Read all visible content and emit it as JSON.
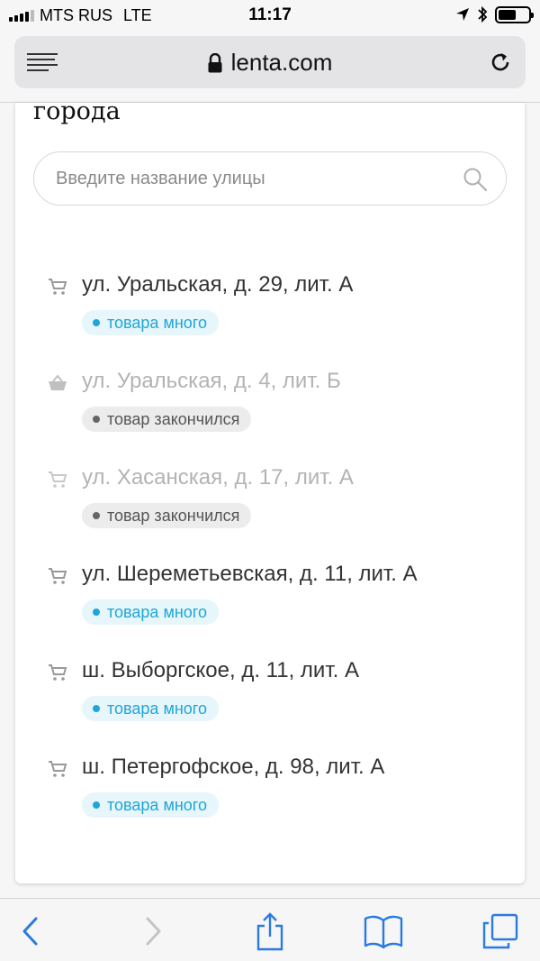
{
  "status_bar": {
    "carrier": "MTS RUS",
    "network": "LTE",
    "time": "11:17"
  },
  "browser": {
    "url": "lenta.com",
    "icons": [
      "menu-icon",
      "lock-icon",
      "reload-icon"
    ]
  },
  "card": {
    "title": "города",
    "search": {
      "placeholder": "Введите название улицы",
      "value": ""
    },
    "stores": [
      {
        "address": "ул. Уральская, д. 29, лит. А",
        "status": "товара много",
        "icon": "cart-icon",
        "available": true
      },
      {
        "address": "ул. Уральская, д. 4, лит. Б",
        "status": "товар закончился",
        "icon": "basket-icon",
        "available": false
      },
      {
        "address": "ул. Хасанская, д. 17, лит. А",
        "status": "товар закончился",
        "icon": "cart-icon",
        "available": false
      },
      {
        "address": "ул. Шереметьевская, д. 11, лит. А",
        "status": "товара много",
        "icon": "cart-icon",
        "available": true
      },
      {
        "address": "ш. Выборгское, д. 11, лит. А",
        "status": "товара много",
        "icon": "cart-icon",
        "available": true
      },
      {
        "address": "ш. Петергофское, д. 98, лит. А",
        "status": "товара много",
        "icon": "cart-icon",
        "available": true
      }
    ]
  },
  "colors": {
    "accent": "#1ea6d8",
    "in_stock_bg": "#e6f6fb",
    "out_of_stock_bg": "#ececec",
    "ios_blue": "#2a7ae2"
  },
  "toolbar": {
    "icons": [
      "back-icon",
      "forward-icon",
      "share-icon",
      "bookmarks-icon",
      "tabs-icon"
    ]
  }
}
